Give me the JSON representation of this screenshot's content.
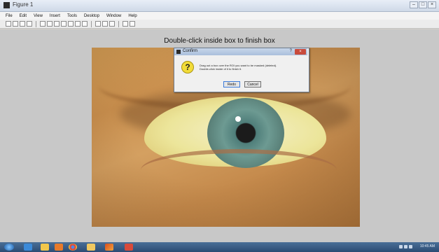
{
  "window": {
    "title": "Figure 1",
    "buttons": [
      "–",
      "□",
      "×"
    ]
  },
  "menubar": {
    "items": [
      "File",
      "Edit",
      "View",
      "Insert",
      "Tools",
      "Desktop",
      "Window",
      "Help"
    ]
  },
  "toolbar": {
    "tools": [
      "new-figure",
      "open",
      "save",
      "print",
      "arrow",
      "zoom-in",
      "zoom-out",
      "pan",
      "rotate",
      "data-cursor",
      "brush",
      "link",
      "colorbar",
      "legend",
      "hide-plot-tools",
      "show-plot-tools"
    ]
  },
  "figure": {
    "instruction": "Double-click inside box to finish box"
  },
  "dialog": {
    "title": "Confirm",
    "help": "?",
    "close": "×",
    "icon": "question-icon",
    "message_lines": [
      "Drag out a box over the ROI you want to be masked (deleted).",
      "Double-click inside of it to finish it."
    ],
    "buttons": {
      "redo": "Redo",
      "cancel": "Cancel"
    }
  },
  "taskbar": {
    "apps": [
      "start",
      "internet-explorer",
      "file-explorer",
      "media-player",
      "chrome",
      "folder",
      "matlab",
      "other-app"
    ],
    "clock": "10:45 AM"
  }
}
